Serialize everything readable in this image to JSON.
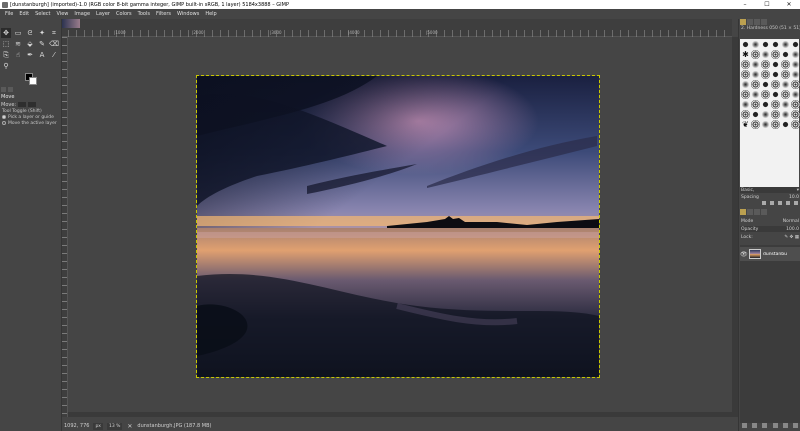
{
  "window": {
    "title": "[dunstanburgh] (imported)-1.0 (RGB color 8-bit gamma integer, GIMP built-in sRGB, 1 layer) 5184x3888 – GIMP",
    "minimize": "–",
    "maximize": "☐",
    "close": "✕"
  },
  "menu": [
    "File",
    "Edit",
    "Select",
    "View",
    "Image",
    "Layer",
    "Colors",
    "Tools",
    "Filters",
    "Windows",
    "Help"
  ],
  "toolbox": {
    "tools": [
      {
        "icon": "move-icon",
        "glyph": "✥"
      },
      {
        "icon": "rect-select-icon",
        "glyph": "▭"
      },
      {
        "icon": "lasso-icon",
        "glyph": "ᘓ"
      },
      {
        "icon": "fuzzy-select-icon",
        "glyph": "✦"
      },
      {
        "icon": "crop-icon",
        "glyph": "⌗"
      },
      {
        "icon": "unified-transform-icon",
        "glyph": "⬚"
      },
      {
        "icon": "warp-icon",
        "glyph": "≋"
      },
      {
        "icon": "bucket-fill-icon",
        "glyph": "⬙"
      },
      {
        "icon": "paintbrush-icon",
        "glyph": "✎"
      },
      {
        "icon": "eraser-icon",
        "glyph": "⌫"
      },
      {
        "icon": "clone-icon",
        "glyph": "⎘"
      },
      {
        "icon": "smudge-icon",
        "glyph": "☝"
      },
      {
        "icon": "paths-icon",
        "glyph": "✒"
      },
      {
        "icon": "text-icon",
        "glyph": "A"
      },
      {
        "icon": "color-picker-icon",
        "glyph": "⁄"
      },
      {
        "icon": "zoom-icon",
        "glyph": "⚲"
      }
    ],
    "options": {
      "title": "Move",
      "move_label": "Move:",
      "toggle_label": "Tool Toggle  (Shift)",
      "option1": "Pick a layer or guide",
      "option2": "Move the active layer"
    }
  },
  "ruler": {
    "labels": [
      {
        "text": "|1000"
      },
      {
        "text": "|2000"
      },
      {
        "text": "|3000"
      },
      {
        "text": "|4000"
      },
      {
        "text": "|5000"
      }
    ]
  },
  "status": {
    "coords": "1092, 776",
    "unit": "px",
    "zoom": "13 %",
    "file": "dunstanburgh.JPG (187.8 MB)"
  },
  "dock": {
    "brush_title": "2. Hardness 050 (51 × 51)",
    "preset": "Basic,",
    "spacing_label": "Spacing",
    "spacing_value": "10.0",
    "mode_label": "Mode",
    "mode_value": "Normal",
    "opacity_label": "Opacity",
    "opacity_value": "100.0",
    "lock_label": "Lock:",
    "layer_name": "dunstanbu"
  },
  "colors": {
    "accent": "#c8c800",
    "background": "#454545"
  }
}
